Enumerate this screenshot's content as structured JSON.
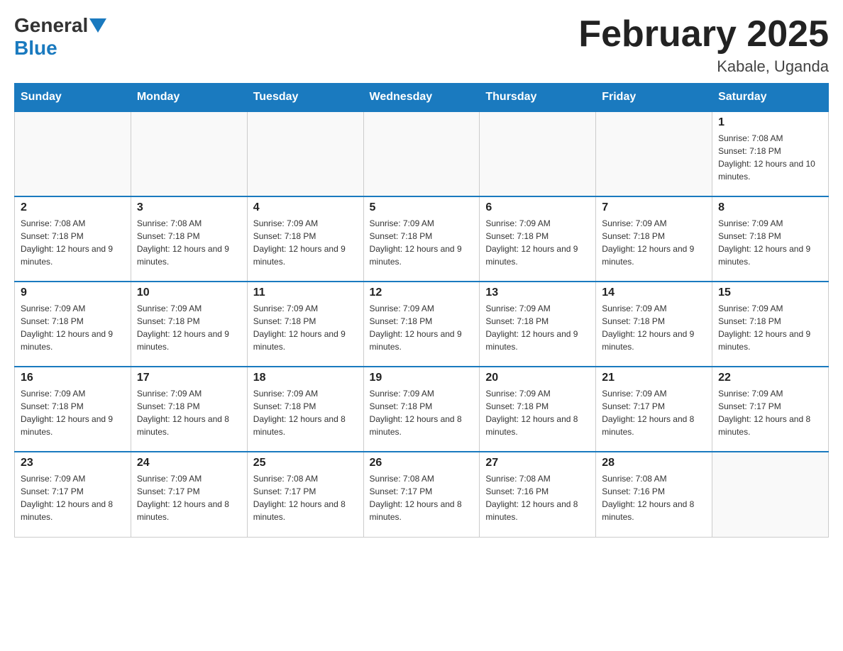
{
  "logo": {
    "general": "General",
    "blue": "Blue"
  },
  "title": "February 2025",
  "location": "Kabale, Uganda",
  "days_header": [
    "Sunday",
    "Monday",
    "Tuesday",
    "Wednesday",
    "Thursday",
    "Friday",
    "Saturday"
  ],
  "weeks": [
    [
      {
        "day": "",
        "info": ""
      },
      {
        "day": "",
        "info": ""
      },
      {
        "day": "",
        "info": ""
      },
      {
        "day": "",
        "info": ""
      },
      {
        "day": "",
        "info": ""
      },
      {
        "day": "",
        "info": ""
      },
      {
        "day": "1",
        "info": "Sunrise: 7:08 AM\nSunset: 7:18 PM\nDaylight: 12 hours and 10 minutes."
      }
    ],
    [
      {
        "day": "2",
        "info": "Sunrise: 7:08 AM\nSunset: 7:18 PM\nDaylight: 12 hours and 9 minutes."
      },
      {
        "day": "3",
        "info": "Sunrise: 7:08 AM\nSunset: 7:18 PM\nDaylight: 12 hours and 9 minutes."
      },
      {
        "day": "4",
        "info": "Sunrise: 7:09 AM\nSunset: 7:18 PM\nDaylight: 12 hours and 9 minutes."
      },
      {
        "day": "5",
        "info": "Sunrise: 7:09 AM\nSunset: 7:18 PM\nDaylight: 12 hours and 9 minutes."
      },
      {
        "day": "6",
        "info": "Sunrise: 7:09 AM\nSunset: 7:18 PM\nDaylight: 12 hours and 9 minutes."
      },
      {
        "day": "7",
        "info": "Sunrise: 7:09 AM\nSunset: 7:18 PM\nDaylight: 12 hours and 9 minutes."
      },
      {
        "day": "8",
        "info": "Sunrise: 7:09 AM\nSunset: 7:18 PM\nDaylight: 12 hours and 9 minutes."
      }
    ],
    [
      {
        "day": "9",
        "info": "Sunrise: 7:09 AM\nSunset: 7:18 PM\nDaylight: 12 hours and 9 minutes."
      },
      {
        "day": "10",
        "info": "Sunrise: 7:09 AM\nSunset: 7:18 PM\nDaylight: 12 hours and 9 minutes."
      },
      {
        "day": "11",
        "info": "Sunrise: 7:09 AM\nSunset: 7:18 PM\nDaylight: 12 hours and 9 minutes."
      },
      {
        "day": "12",
        "info": "Sunrise: 7:09 AM\nSunset: 7:18 PM\nDaylight: 12 hours and 9 minutes."
      },
      {
        "day": "13",
        "info": "Sunrise: 7:09 AM\nSunset: 7:18 PM\nDaylight: 12 hours and 9 minutes."
      },
      {
        "day": "14",
        "info": "Sunrise: 7:09 AM\nSunset: 7:18 PM\nDaylight: 12 hours and 9 minutes."
      },
      {
        "day": "15",
        "info": "Sunrise: 7:09 AM\nSunset: 7:18 PM\nDaylight: 12 hours and 9 minutes."
      }
    ],
    [
      {
        "day": "16",
        "info": "Sunrise: 7:09 AM\nSunset: 7:18 PM\nDaylight: 12 hours and 9 minutes."
      },
      {
        "day": "17",
        "info": "Sunrise: 7:09 AM\nSunset: 7:18 PM\nDaylight: 12 hours and 8 minutes."
      },
      {
        "day": "18",
        "info": "Sunrise: 7:09 AM\nSunset: 7:18 PM\nDaylight: 12 hours and 8 minutes."
      },
      {
        "day": "19",
        "info": "Sunrise: 7:09 AM\nSunset: 7:18 PM\nDaylight: 12 hours and 8 minutes."
      },
      {
        "day": "20",
        "info": "Sunrise: 7:09 AM\nSunset: 7:18 PM\nDaylight: 12 hours and 8 minutes."
      },
      {
        "day": "21",
        "info": "Sunrise: 7:09 AM\nSunset: 7:17 PM\nDaylight: 12 hours and 8 minutes."
      },
      {
        "day": "22",
        "info": "Sunrise: 7:09 AM\nSunset: 7:17 PM\nDaylight: 12 hours and 8 minutes."
      }
    ],
    [
      {
        "day": "23",
        "info": "Sunrise: 7:09 AM\nSunset: 7:17 PM\nDaylight: 12 hours and 8 minutes."
      },
      {
        "day": "24",
        "info": "Sunrise: 7:09 AM\nSunset: 7:17 PM\nDaylight: 12 hours and 8 minutes."
      },
      {
        "day": "25",
        "info": "Sunrise: 7:08 AM\nSunset: 7:17 PM\nDaylight: 12 hours and 8 minutes."
      },
      {
        "day": "26",
        "info": "Sunrise: 7:08 AM\nSunset: 7:17 PM\nDaylight: 12 hours and 8 minutes."
      },
      {
        "day": "27",
        "info": "Sunrise: 7:08 AM\nSunset: 7:16 PM\nDaylight: 12 hours and 8 minutes."
      },
      {
        "day": "28",
        "info": "Sunrise: 7:08 AM\nSunset: 7:16 PM\nDaylight: 12 hours and 8 minutes."
      },
      {
        "day": "",
        "info": ""
      }
    ]
  ]
}
